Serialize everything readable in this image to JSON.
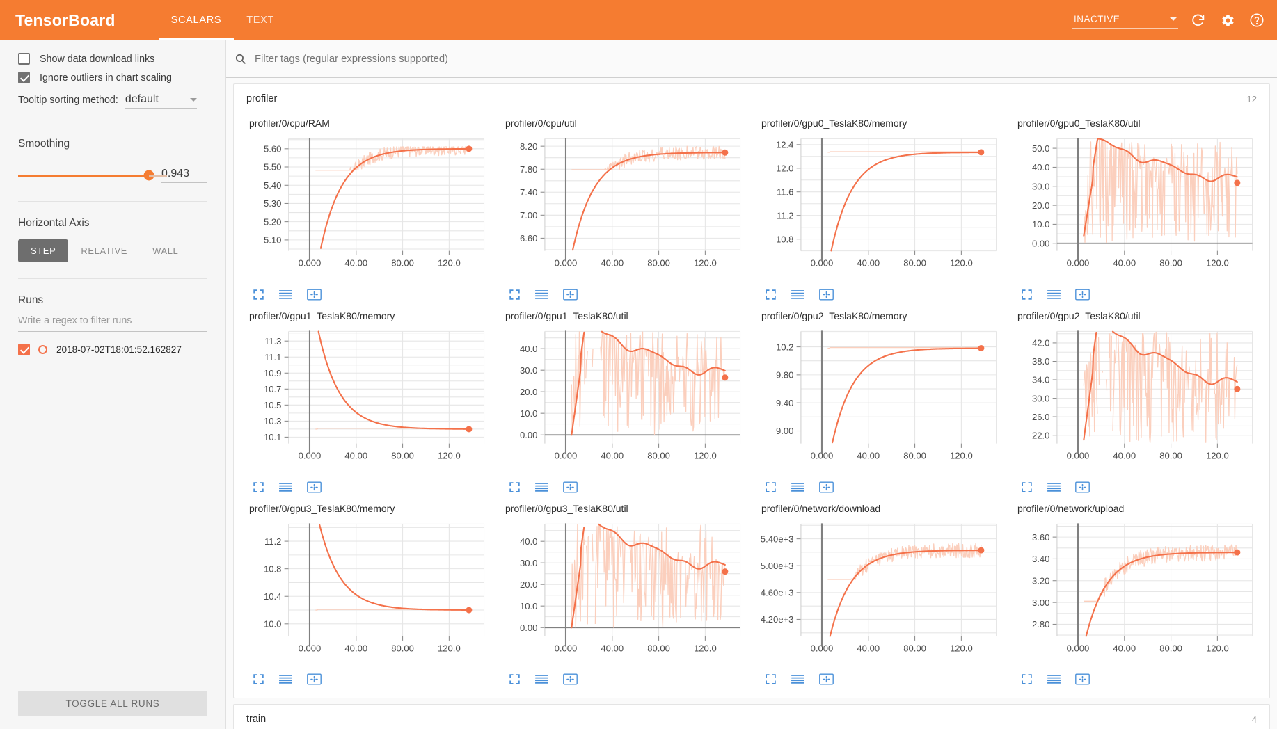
{
  "header": {
    "brand": "TensorBoard",
    "tabs": [
      {
        "label": "SCALARS",
        "active": true
      },
      {
        "label": "TEXT",
        "active": false
      }
    ],
    "run_status": "INACTIVE",
    "icons": [
      "refresh-icon",
      "gear-icon",
      "help-icon"
    ],
    "accent_color": "#f57c31"
  },
  "sidebar": {
    "show_download_links": {
      "label": "Show data download links",
      "checked": false
    },
    "ignore_outliers": {
      "label": "Ignore outliers in chart scaling",
      "checked": true
    },
    "tooltip_sort": {
      "label": "Tooltip sorting method:",
      "value": "default"
    },
    "smoothing": {
      "title": "Smoothing",
      "value": "0.943",
      "percent": 100
    },
    "horizontal_axis": {
      "title": "Horizontal Axis",
      "options": [
        "STEP",
        "RELATIVE",
        "WALL"
      ],
      "selected": "STEP"
    },
    "runs": {
      "title": "Runs",
      "filter_placeholder": "Write a regex to filter runs",
      "items": [
        {
          "name": "2018-07-02T18:01:52.162827",
          "checked": true,
          "color": "#f4714a"
        }
      ],
      "toggle_all_label": "TOGGLE ALL RUNS"
    }
  },
  "main": {
    "filter_placeholder": "Filter tags (regular expressions supported)",
    "groups": [
      {
        "name": "profiler",
        "count": "12",
        "expanded": true
      },
      {
        "name": "train",
        "count": "4",
        "expanded": false
      }
    ]
  },
  "chart_data": {
    "type": "line",
    "series_color": "#f4714a",
    "raw_color": "#fbcfbd",
    "xlabel": "",
    "xticks": [
      "0.000",
      "40.00",
      "80.00",
      "120.0"
    ],
    "xlim": [
      -18,
      150
    ],
    "smoothing": 0.943,
    "charts": [
      {
        "title": "profiler/0/cpu/RAM",
        "ylabel": "",
        "yticks": [
          "5.10",
          "5.20",
          "5.30",
          "5.40",
          "5.50",
          "5.60"
        ],
        "ylim": [
          5.04,
          5.655
        ],
        "raw_band": [
          5.5,
          5.6
        ],
        "last_value": 5.6,
        "shape": "rise-saturate",
        "start_value": 4.9,
        "end_value": 5.6,
        "noise": 0.006
      },
      {
        "title": "profiler/0/cpu/util",
        "ylabel": "",
        "yticks": [
          "6.60",
          "7.00",
          "7.40",
          "7.80",
          "8.20"
        ],
        "ylim": [
          6.38,
          8.33
        ],
        "raw_band": [
          7.85,
          8.25
        ],
        "last_value": 8.09,
        "shape": "rise-saturate",
        "start_value": 6.3,
        "end_value": 8.09,
        "noise": 0.02
      },
      {
        "title": "profiler/0/gpu0_TeslaK80/memory",
        "ylabel": "",
        "yticks": [
          "10.8",
          "11.2",
          "11.6",
          "12.0",
          "12.4"
        ],
        "ylim": [
          10.6,
          12.5
        ],
        "raw_band": [
          12.27,
          12.28
        ],
        "last_value": 12.27,
        "shape": "rise-saturate",
        "start_value": 10.3,
        "end_value": 12.27,
        "noise": 0.0
      },
      {
        "title": "profiler/0/gpu0_TeslaK80/util",
        "ylabel": "",
        "yticks": [
          "0.00",
          "10.0",
          "20.0",
          "30.0",
          "40.0",
          "50.0"
        ],
        "ylim": [
          -4,
          55
        ],
        "raw_band": [
          0,
          55
        ],
        "last_value": 31.8,
        "shape": "noisy-plateau",
        "start_value": 4,
        "peak_value": 49,
        "end_value": 31.8,
        "noise": 3.0
      },
      {
        "title": "profiler/0/gpu1_TeslaK80/memory",
        "ylabel": "",
        "yticks": [
          "10.1",
          "10.3",
          "10.5",
          "10.7",
          "10.9",
          "11.1",
          "11.3"
        ],
        "ylim": [
          10.02,
          11.42
        ],
        "raw_band": [
          10.2,
          10.21
        ],
        "last_value": 10.2,
        "shape": "decay-saturate",
        "start_value": 11.6,
        "end_value": 10.2,
        "noise": 0.0
      },
      {
        "title": "profiler/0/gpu1_TeslaK80/util",
        "ylabel": "",
        "yticks": [
          "0.00",
          "10.0",
          "20.0",
          "30.0",
          "40.0"
        ],
        "ylim": [
          -4,
          48
        ],
        "raw_band": [
          0,
          48
        ],
        "last_value": 26.6,
        "shape": "noisy-plateau",
        "start_value": 0,
        "peak_value": 46,
        "end_value": 26.6,
        "noise": 3.0
      },
      {
        "title": "profiler/0/gpu2_TeslaK80/memory",
        "ylabel": "",
        "yticks": [
          "9.00",
          "9.40",
          "9.80",
          "10.2"
        ],
        "ylim": [
          8.82,
          10.42
        ],
        "raw_band": [
          10.18,
          10.19
        ],
        "last_value": 10.18,
        "shape": "rise-saturate",
        "start_value": 8.5,
        "end_value": 10.18,
        "noise": 0.0
      },
      {
        "title": "profiler/0/gpu2_TeslaK80/util",
        "ylabel": "",
        "yticks": [
          "22.0",
          "26.0",
          "30.0",
          "34.0",
          "38.0",
          "42.0"
        ],
        "ylim": [
          20.2,
          44.5
        ],
        "raw_band": [
          20.2,
          44.5
        ],
        "last_value": 32.0,
        "shape": "noisy-plateau",
        "start_value": 21,
        "peak_value": 43.5,
        "end_value": 32.0,
        "noise": 2.3
      },
      {
        "title": "profiler/0/gpu3_TeslaK80/memory",
        "ylabel": "",
        "yticks": [
          "10.0",
          "10.4",
          "10.8",
          "11.2"
        ],
        "ylim": [
          9.82,
          11.45
        ],
        "raw_band": [
          10.2,
          10.21
        ],
        "last_value": 10.2,
        "shape": "decay-saturate",
        "start_value": 11.7,
        "end_value": 10.2,
        "noise": 0.0
      },
      {
        "title": "profiler/0/gpu3_TeslaK80/util",
        "ylabel": "",
        "yticks": [
          "0.00",
          "10.0",
          "20.0",
          "30.0",
          "40.0"
        ],
        "ylim": [
          -4,
          48
        ],
        "raw_band": [
          0,
          48
        ],
        "last_value": 26.0,
        "shape": "noisy-plateau",
        "start_value": 0,
        "peak_value": 45,
        "end_value": 26.0,
        "noise": 3.0
      },
      {
        "title": "profiler/0/network/download",
        "ylabel": "",
        "yticks": [
          "4.20e+3",
          "4.60e+3",
          "5.00e+3",
          "5.40e+3"
        ],
        "ylim": [
          3950,
          5620
        ],
        "raw_band": [
          4850,
          5600
        ],
        "last_value": 5230,
        "shape": "rise-saturate",
        "start_value": 3800,
        "end_value": 5230,
        "noise": 18
      },
      {
        "title": "profiler/0/network/upload",
        "ylabel": "",
        "yticks": [
          "2.80",
          "3.00",
          "3.20",
          "3.40",
          "3.60"
        ],
        "ylim": [
          2.69,
          3.72
        ],
        "raw_band": [
          3.05,
          3.72
        ],
        "last_value": 3.46,
        "shape": "rise-saturate",
        "start_value": 2.6,
        "end_value": 3.46,
        "noise": 0.013
      }
    ]
  }
}
